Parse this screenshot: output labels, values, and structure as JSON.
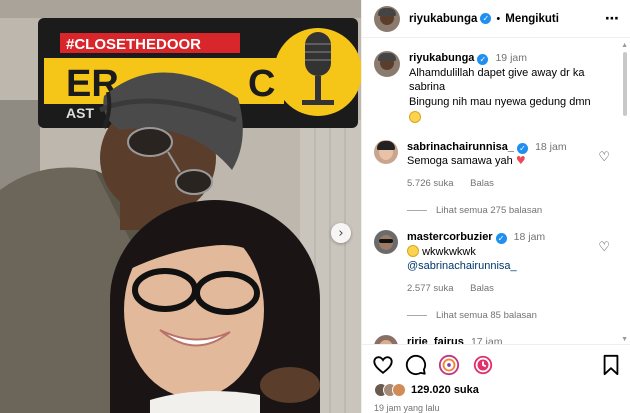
{
  "header": {
    "username": "riyukabunga",
    "separator": "•",
    "follow_label": "Mengikuti",
    "more_icon": "⋯"
  },
  "caption": {
    "username": "riyukabunga",
    "time": "19 jam",
    "text_line1": "Alhamdulillah dapet give away dr ka",
    "text_line2": "sabrina",
    "text_line3": "Bingung nih mau nyewa gedung dmn"
  },
  "comments": [
    {
      "username": "sabrinachairunnisa_",
      "time": "18 jam",
      "text": "Semoga samawa yah",
      "likes": "5.726 suka",
      "reply": "Balas",
      "view_replies": "Lihat semua 275 balasan"
    },
    {
      "username": "mastercorbuzier",
      "time": "18 jam",
      "text": "wkwkwkwk",
      "mention": "@sabrinachairunnisa_",
      "likes": "2.577 suka",
      "reply": "Balas",
      "view_replies": "Lihat semua 85 balasan"
    },
    {
      "username": "ririe_fairus",
      "time": "17 jam"
    }
  ],
  "photo": {
    "sign_text_top": "#CLOSETHEDOOR",
    "sign_text_mid": "CO",
    "sign_text_left": "ER",
    "sign_text_bottom": "AST",
    "sign_text_right": "CO"
  },
  "footer": {
    "likes_count": "129.020 suka",
    "timestamp": "19 jam yang lalu"
  },
  "colors": {
    "verified": "#1f8ff0",
    "sign_yellow": "#f5c518",
    "sign_red": "#d9262b",
    "heart_red": "#ed4956"
  }
}
